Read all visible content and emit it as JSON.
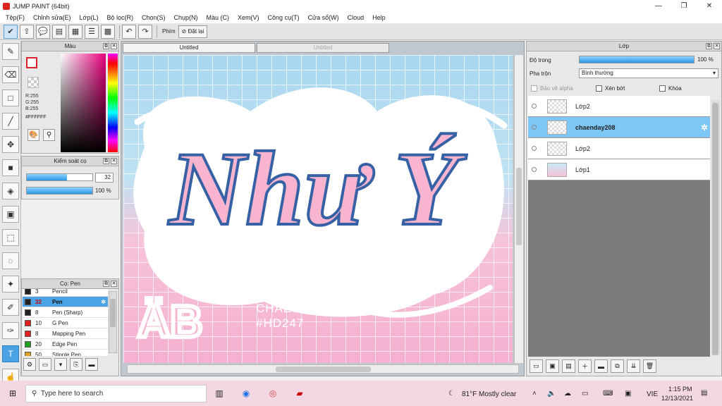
{
  "window": {
    "title": "JUMP PAINT (64bit)",
    "min": "—",
    "max": "❐",
    "close": "✕"
  },
  "menu": [
    "Tệp(F)",
    "Chỉnh sửa(E)",
    "Lớp(L)",
    "Bộ lọc(R)",
    "Chọn(S)",
    "Chụp(N)",
    "Màu (C)",
    "Xem(V)",
    "Công cụ(T)",
    "Cửa sổ(W)",
    "Cloud",
    "Help"
  ],
  "toolbar": {
    "shortcut_label": "Phím",
    "reset_label": "Đặt lại"
  },
  "color_panel": {
    "title": "Màu",
    "r": "R:255",
    "g": "G:255",
    "b": "B:255",
    "hex": "#FFFFFF"
  },
  "control_panel": {
    "title": "Kiểm soát cọ",
    "size_value": "32",
    "size_fraction": 0.32,
    "opacity_label": "100 %",
    "opacity_fraction": 1.0
  },
  "brush_panel": {
    "title": "Cọ: Pen",
    "brushes": [
      {
        "size": "3",
        "name": "Pencil",
        "color": "#222222"
      },
      {
        "size": "32",
        "name": "Pen",
        "color": "#222222",
        "selected": true
      },
      {
        "size": "8",
        "name": "Pen (Sharp)",
        "color": "#222222"
      },
      {
        "size": "10",
        "name": "G Pen",
        "color": "#e02020"
      },
      {
        "size": "8",
        "name": "Mapping Pen",
        "color": "#e02020"
      },
      {
        "size": "20",
        "name": "Edge Pen",
        "color": "#20a020"
      },
      {
        "size": "50",
        "name": "Stipple Pen",
        "color": "#e0a020"
      }
    ]
  },
  "canvas": {
    "tabs": [
      "Untitled",
      "Untitled"
    ],
    "artwork": {
      "main_text": "Như Ý",
      "sub_mark": "ÄB",
      "signature": "CHAENDAY208",
      "hashtag": "#HD247"
    }
  },
  "layer_panel": {
    "title": "Lớp",
    "opacity_label": "Độ trong",
    "opacity_value": "100 %",
    "blend_label": "Pha trộn",
    "blend_value": "Bình thường",
    "alpha_protect": "Bảo vệ alpha",
    "clipping": "Xén bớt",
    "lock": "Khóa",
    "layers": [
      {
        "name": "Lớp2",
        "thumb": "checker"
      },
      {
        "name": "chaenday208",
        "thumb": "checker",
        "selected": true
      },
      {
        "name": "Lớp2",
        "thumb": "checker"
      },
      {
        "name": "Lớp1",
        "thumb": "pink"
      }
    ]
  },
  "taskbar": {
    "search_placeholder": "Type here to search",
    "weather": "81°F  Mostly clear",
    "lang": "VIE",
    "time": "1:15 PM",
    "date": "12/13/2021"
  }
}
